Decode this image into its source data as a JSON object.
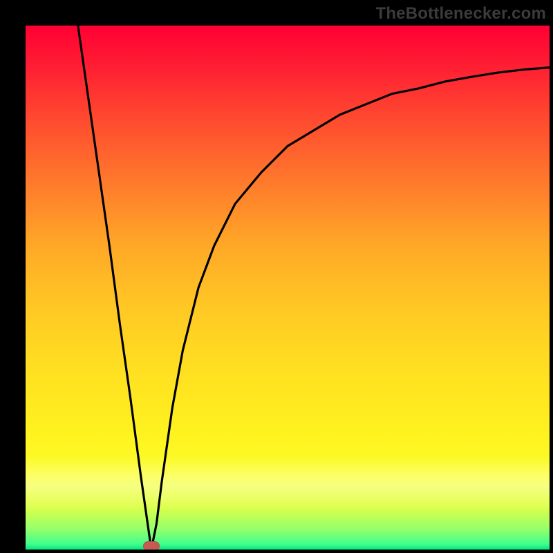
{
  "watermark": "TheBottlenecker.com",
  "chart_data": {
    "type": "line",
    "title": "",
    "xlabel": "",
    "ylabel": "",
    "xlim": [
      0,
      100
    ],
    "ylim": [
      0,
      100
    ],
    "grid": false,
    "legend": false,
    "annotations": [
      {
        "kind": "pill-marker",
        "x": 24,
        "y": 0,
        "color": "#c85b51"
      }
    ],
    "gradient_stops": [
      {
        "pos": 0.0,
        "color": "#ff0033"
      },
      {
        "pos": 0.5,
        "color": "#ffc824"
      },
      {
        "pos": 0.8,
        "color": "#fff21f"
      },
      {
        "pos": 1.0,
        "color": "#07e27d"
      }
    ],
    "series": [
      {
        "name": "curve",
        "color": "#000000",
        "x": [
          10,
          12,
          14,
          16,
          18,
          20,
          22,
          23,
          24,
          25,
          26,
          28,
          30,
          33,
          36,
          40,
          45,
          50,
          55,
          60,
          65,
          70,
          75,
          80,
          85,
          90,
          95,
          100
        ],
        "y": [
          100,
          86,
          72,
          58,
          43,
          29,
          14,
          7,
          0,
          5,
          13,
          27,
          38,
          50,
          58,
          66,
          72,
          77,
          80,
          83,
          85,
          87,
          88,
          89.3,
          90.2,
          91,
          91.6,
          92
        ]
      }
    ]
  }
}
